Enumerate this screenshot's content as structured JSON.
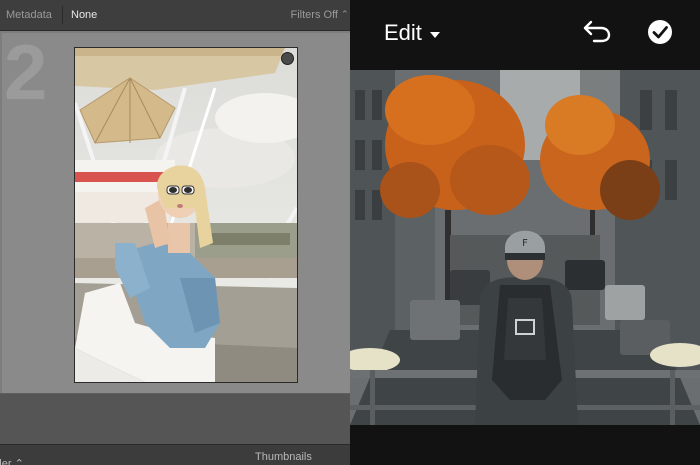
{
  "lightroom": {
    "filter_bar": {
      "metadata_label": "Metadata",
      "none_label": "None",
      "filters_label": "Filters Off"
    },
    "grid": {
      "cell_index": "2"
    },
    "toolbar": {
      "sort_label": "rder ⌃",
      "thumbnails_label": "Thumbnails"
    }
  },
  "mobile_edit": {
    "title": "Edit",
    "undo_icon": "undo-icon",
    "confirm_icon": "check-circle-icon"
  },
  "colors": {
    "lightroom_bg": "#606060",
    "mobile_bg": "#121212",
    "foliage_orange": "#d6701e"
  }
}
